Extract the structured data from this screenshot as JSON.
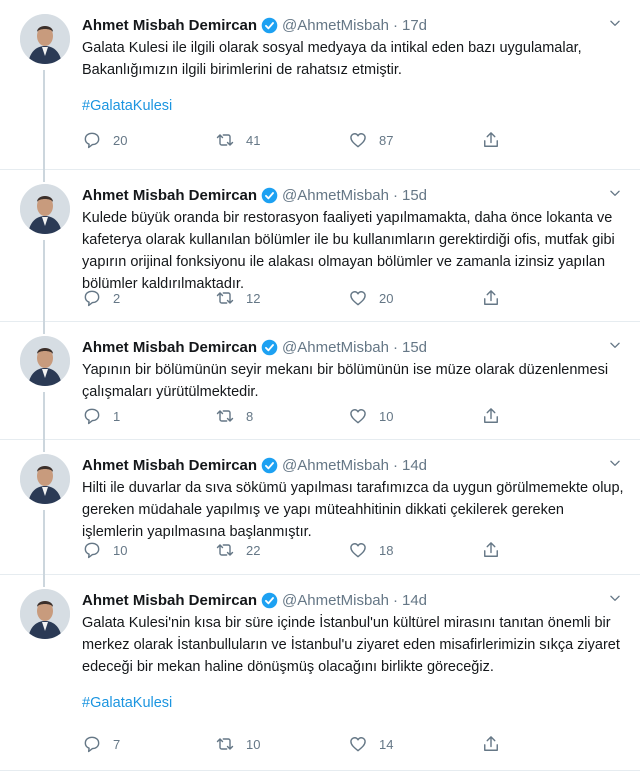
{
  "tweets": [
    {
      "name": "Ahmet Misbah Demircan",
      "handle": "@AhmetMisbah",
      "separator": "·",
      "time": "17d",
      "text": "Galata Kulesi ile ilgili olarak sosyal medyaya da intikal eden bazı uygulamalar, Bakanlığımızın ilgili birimlerini de rahatsız etmiştir.",
      "hashtag": "#GalataKulesi",
      "replies": "20",
      "retweets": "41",
      "likes": "87"
    },
    {
      "name": "Ahmet Misbah Demircan",
      "handle": "@AhmetMisbah",
      "separator": "·",
      "time": "15d",
      "text": "Kulede büyük oranda bir restorasyon faaliyeti yapılmamakta, daha önce lokanta ve kafeterya olarak kullanılan bölümler ile bu kullanımların gerektirdiği ofis, mutfak gibi yapırın orijinal fonksiyonu ile alakası olmayan bölümler ve zamanla izinsiz yapılan bölümler kaldırılmaktadır.",
      "hashtag": "",
      "replies": "2",
      "retweets": "12",
      "likes": "20"
    },
    {
      "name": "Ahmet Misbah Demircan",
      "handle": "@AhmetMisbah",
      "separator": "·",
      "time": "15d",
      "text": "Yapının bir bölümünün seyir mekanı bir bölümünün ise müze olarak düzenlenmesi çalışmaları yürütülmektedir.",
      "hashtag": "",
      "replies": "1",
      "retweets": "8",
      "likes": "10"
    },
    {
      "name": "Ahmet Misbah Demircan",
      "handle": "@AhmetMisbah",
      "separator": "·",
      "time": "14d",
      "text": "Hilti ile duvarlar da sıva sökümü yapılması tarafımızca da uygun görülmemekte olup, gereken müdahale yapılmış ve yapı müteahhitinin dikkati çekilerek gereken işlemlerin yapılmasına başlanmıştır.",
      "hashtag": "",
      "replies": "10",
      "retweets": "22",
      "likes": "18"
    },
    {
      "name": "Ahmet Misbah Demircan",
      "handle": "@AhmetMisbah",
      "separator": "·",
      "time": "14d",
      "text": "Galata Kulesi'nin kısa bir süre içinde İstanbul'un kültürel mirasını tanıtan önemli bir merkez olarak İstanbulluların ve İstanbul'u ziyaret eden misafirlerimizin sıkça ziyaret edeceği bir mekan haline dönüşmüş olacağını birlikte göreceğiz.",
      "hashtag": "#GalataKulesi",
      "replies": "7",
      "retweets": "10",
      "likes": "14"
    }
  ],
  "icons": {
    "reply": "reply-icon",
    "retweet": "retweet-icon",
    "like": "like-icon",
    "share": "share-icon",
    "verified": "verified-badge-icon",
    "caret": "chevron-down-icon"
  },
  "colors": {
    "accent": "#1da1f2",
    "hashtag": "#1b95e0",
    "secondary_text": "#657786",
    "thread_line": "#ccd6dd"
  }
}
